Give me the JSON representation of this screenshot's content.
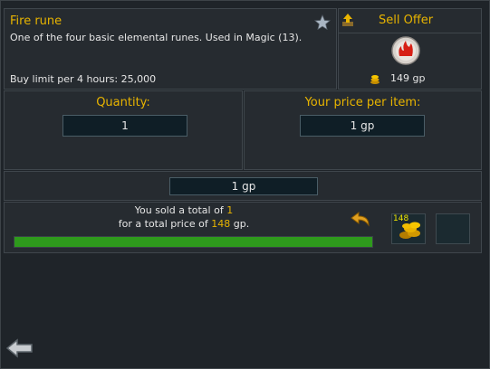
{
  "item": {
    "name": "Fire rune",
    "description": "One of the four basic elemental runes. Used in Magic (13).",
    "buy_limit": "Buy limit per 4 hours: 25,000",
    "icon": "fire-rune-icon"
  },
  "offer": {
    "type_label": "Sell Offer",
    "price_display": "149 gp"
  },
  "quantity": {
    "label": "Quantity:",
    "value": "1"
  },
  "price_per_item": {
    "label": "Your price per item:",
    "value": "1 gp"
  },
  "total": {
    "value": "1 gp"
  },
  "status": {
    "line1_prefix": "You sold a total of ",
    "line1_value": "1",
    "line2_prefix": "for a total price of ",
    "line2_value": "148",
    "line2_suffix": " gp.",
    "progress": 1.0,
    "progress_color": "#2e9a1c",
    "coins_count": "148"
  },
  "colors": {
    "gold": "#e8b400",
    "panel": "#262b30",
    "bg": "#1f2429"
  }
}
